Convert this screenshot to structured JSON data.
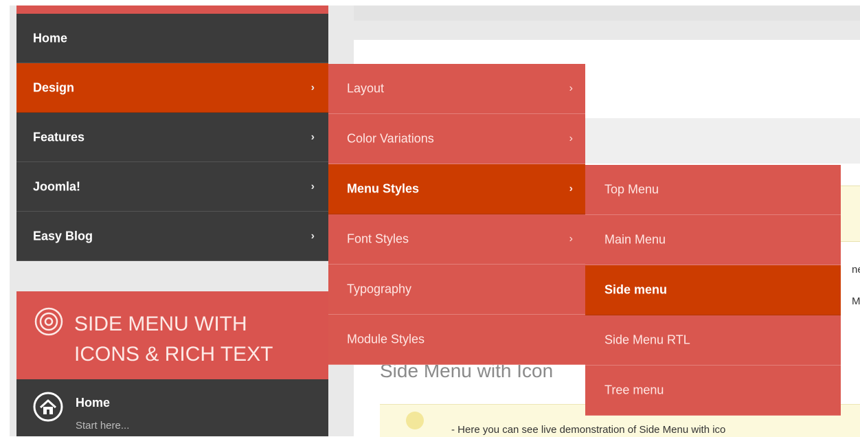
{
  "main_menu": {
    "items": [
      {
        "label": "Home",
        "chevron": ""
      },
      {
        "label": "Design",
        "chevron": "›"
      },
      {
        "label": "Features",
        "chevron": "›"
      },
      {
        "label": "Joomla!",
        "chevron": "›"
      },
      {
        "label": "Easy Blog",
        "chevron": "›"
      }
    ],
    "active_index": 1
  },
  "design_submenu": {
    "items": [
      {
        "label": "Layout",
        "chevron": "›"
      },
      {
        "label": "Color Variations",
        "chevron": "›"
      },
      {
        "label": "Menu Styles",
        "chevron": "›"
      },
      {
        "label": "Font Styles",
        "chevron": "›"
      },
      {
        "label": "Typography",
        "chevron": ""
      },
      {
        "label": "Module Styles",
        "chevron": ""
      }
    ],
    "active_index": 2
  },
  "menu_styles_submenu": {
    "items": [
      {
        "label": "Top Menu"
      },
      {
        "label": "Main Menu"
      },
      {
        "label": "Side menu"
      },
      {
        "label": "Side Menu RTL"
      },
      {
        "label": "Tree menu"
      }
    ],
    "active_index": 2
  },
  "side_module": {
    "title": "SIDE MENU WITH ICONS & RICH TEXT",
    "icon": "target-icon",
    "first_item": {
      "title": "Home",
      "subtitle": "Start here...",
      "icon": "home-icon"
    }
  },
  "content": {
    "heading": "Side Menu with Icon",
    "right_text_1": "ne",
    "right_text_2": "Me",
    "intro_text": "Here you can see live demonstration of Side Menu with ico"
  },
  "colors": {
    "dark_menu": "#3b3b3b",
    "active_orange": "#cc3c00",
    "flyout_red": "#d9574f"
  }
}
